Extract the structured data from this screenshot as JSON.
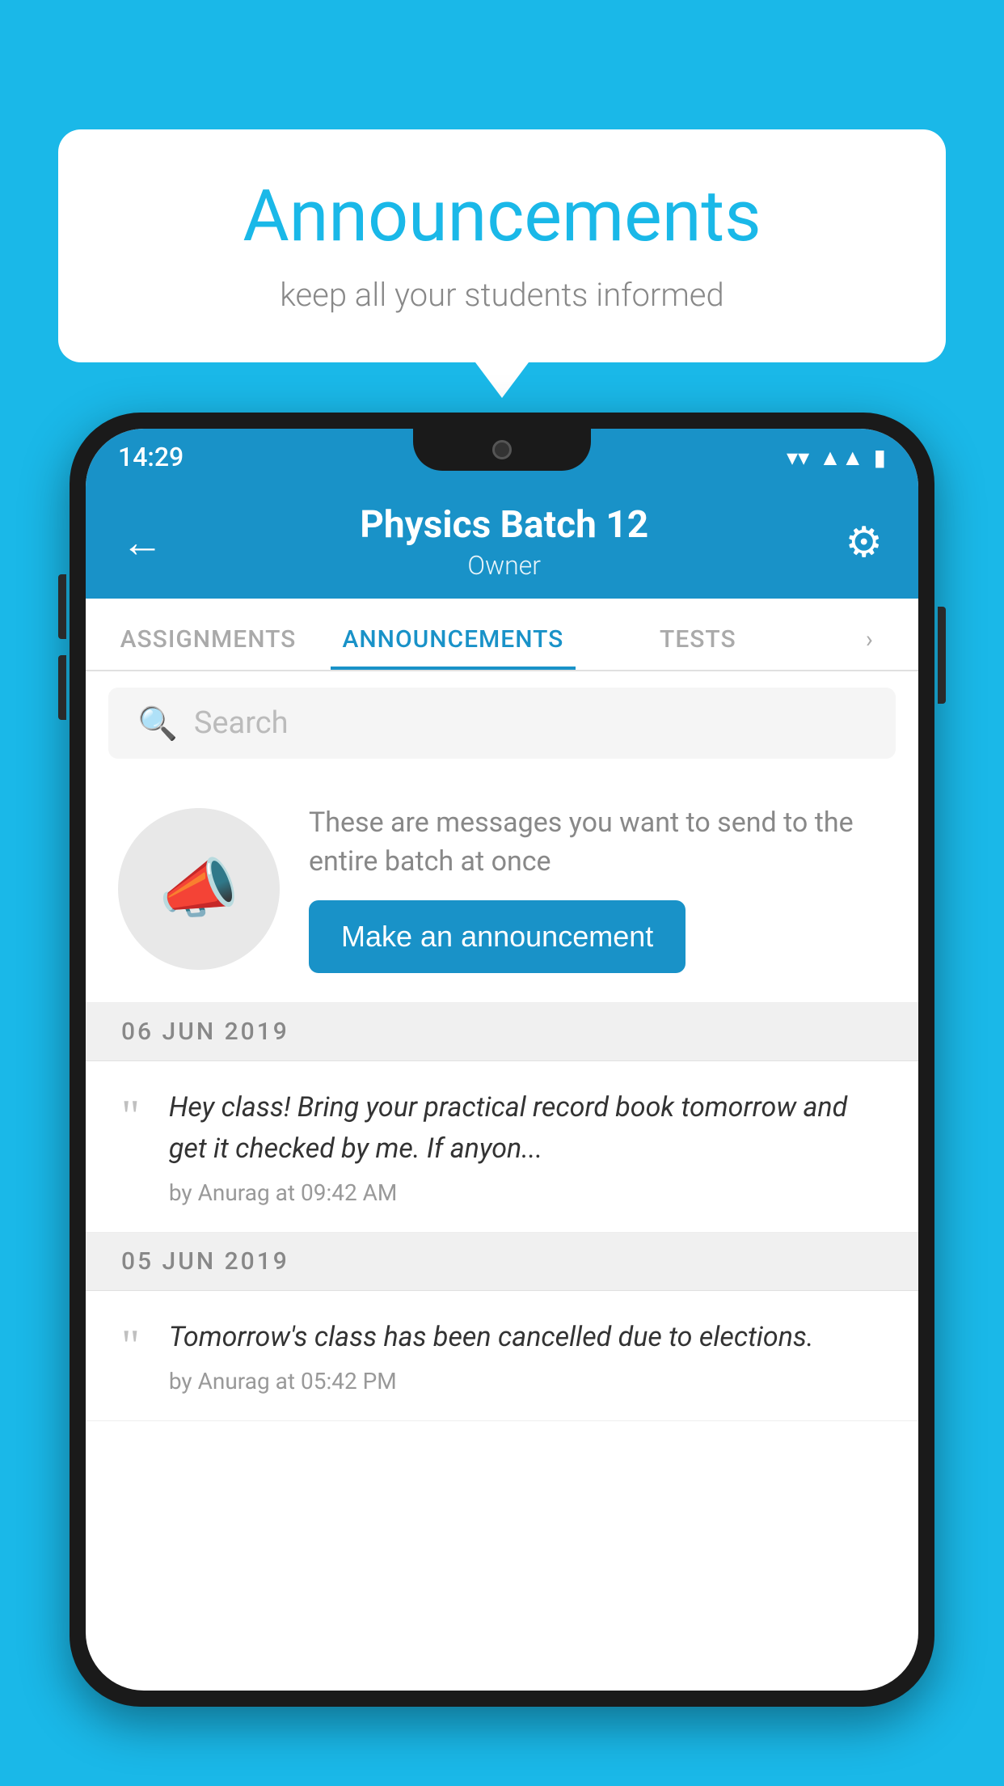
{
  "page": {
    "background_color": "#1ab8e8"
  },
  "speech_bubble": {
    "title": "Announcements",
    "subtitle": "keep all your students informed"
  },
  "status_bar": {
    "time": "14:29",
    "wifi_icon": "▼",
    "signal_icon": "▲",
    "battery_icon": "▮"
  },
  "app_header": {
    "back_label": "←",
    "title": "Physics Batch 12",
    "subtitle": "Owner",
    "gear_symbol": "⚙"
  },
  "tabs": [
    {
      "label": "ASSIGNMENTS",
      "active": false
    },
    {
      "label": "ANNOUNCEMENTS",
      "active": true
    },
    {
      "label": "TESTS",
      "active": false
    }
  ],
  "search": {
    "placeholder": "Search"
  },
  "promo": {
    "description_text": "These are messages you want to send to the entire batch at once",
    "button_label": "Make an announcement"
  },
  "dates": [
    {
      "label": "06  JUN  2019",
      "announcements": [
        {
          "text": "Hey class! Bring your practical record book tomorrow and get it checked by me. If anyon...",
          "meta": "by Anurag at 09:42 AM"
        }
      ]
    },
    {
      "label": "05  JUN  2019",
      "announcements": [
        {
          "text": "Tomorrow's class has been cancelled due to elections.",
          "meta": "by Anurag at 05:42 PM"
        }
      ]
    }
  ]
}
